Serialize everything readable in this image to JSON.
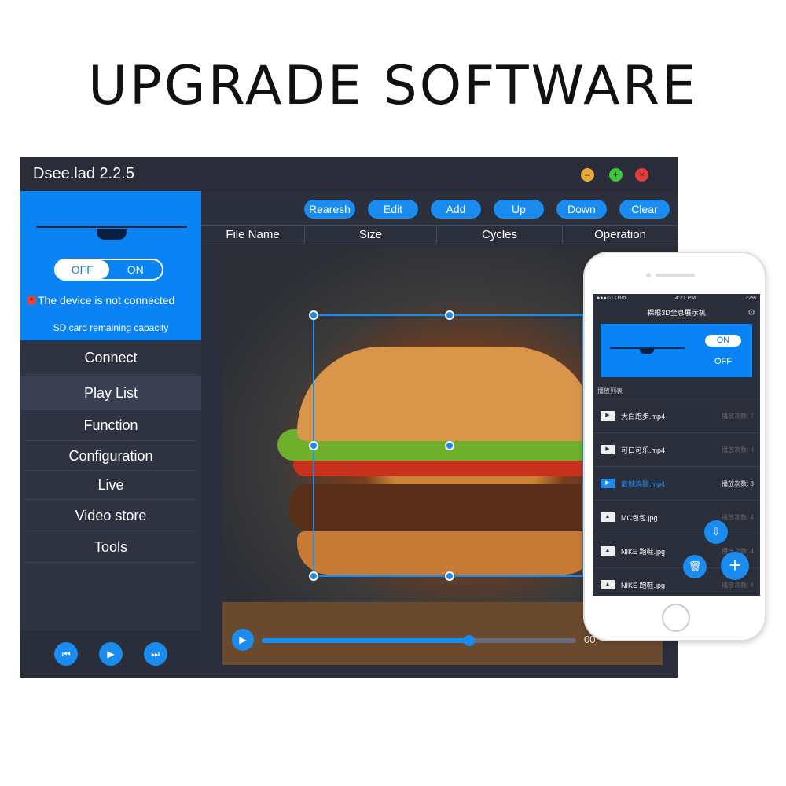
{
  "headline": "UPGRADE SOFTWARE",
  "app": {
    "title": "Dsee.lad 2.2.5",
    "window_controls": [
      {
        "name": "minimize",
        "color": "#e8a93a",
        "glyph": "–"
      },
      {
        "name": "maximize",
        "color": "#3ec43e",
        "glyph": "+"
      },
      {
        "name": "close",
        "color": "#ea3b3b",
        "glyph": "×"
      }
    ],
    "device": {
      "toggle_off": "OFF",
      "toggle_on": "ON",
      "status": "The device is not connected",
      "sd_label": "SD card remaining capacity"
    },
    "nav": [
      "Connect",
      "Play List",
      "Function",
      "Configuration",
      "Live",
      "Video store",
      "Tools"
    ],
    "active_nav": "Play List",
    "toolbar": [
      "Rearesh",
      "Edit",
      "Add",
      "Up",
      "Down",
      "Clear"
    ],
    "columns": [
      "File Name",
      "Size",
      "Cycles",
      "Operation"
    ],
    "transport": [
      "previous-icon",
      "play-icon",
      "next-icon"
    ],
    "player": {
      "progress_percent": 66,
      "time": "00:"
    },
    "accent": "#1a8cf0"
  },
  "phone": {
    "status": {
      "carrier": "●●●○○ Divo",
      "time": "4:21 PM",
      "battery": "22%"
    },
    "title": "裸眼3D全息展示机",
    "toggle_on": "ON",
    "toggle_off": "OFF",
    "list_label": "播放列表",
    "items": [
      {
        "name": "大白跑步.mp4",
        "count": "播放次数: 7",
        "type": "video"
      },
      {
        "name": "可口可乐.mp4",
        "count": "播放次数: 8",
        "type": "video"
      },
      {
        "name": "戴城鸡腿.mp4",
        "count": "播放次数: 8",
        "type": "video",
        "highlight": true
      },
      {
        "name": "MC包包.jpg",
        "count": "播放次数: 4",
        "type": "image"
      },
      {
        "name": "NIKE 跑鞋.jpg",
        "count": "播放次数: 4",
        "type": "image"
      },
      {
        "name": "NIKE 跑鞋.jpg",
        "count": "播放次数: 4",
        "type": "image"
      }
    ]
  }
}
